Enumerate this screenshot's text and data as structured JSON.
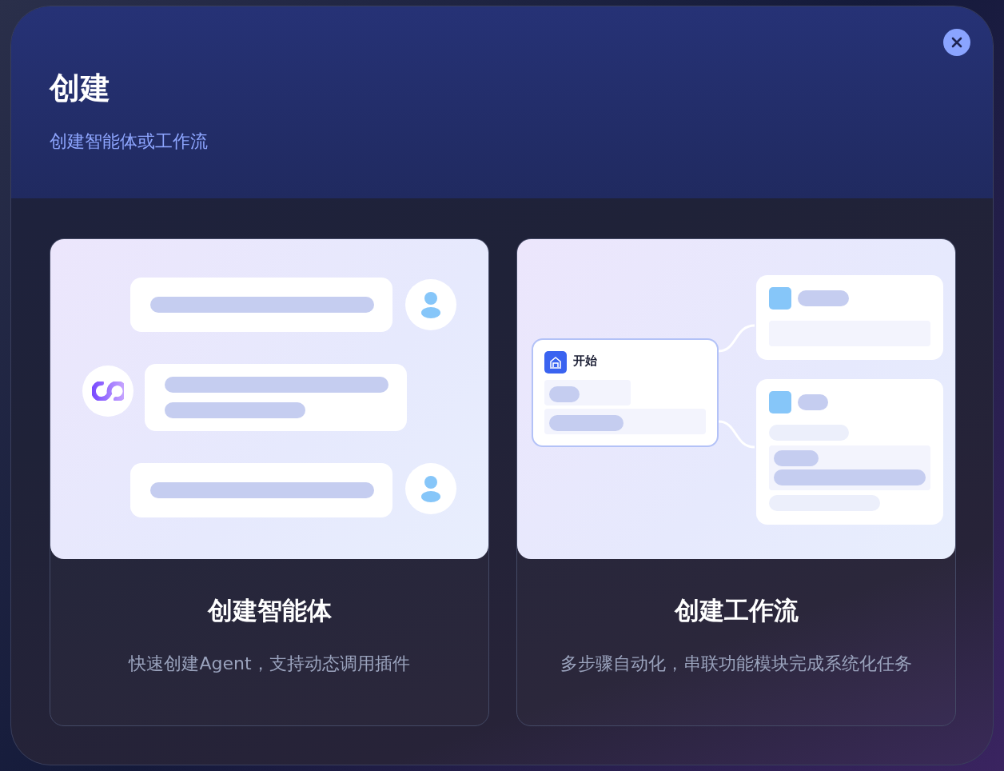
{
  "dialog": {
    "title": "创建",
    "subtitle": "创建智能体或工作流"
  },
  "cards": [
    {
      "kind": "agent",
      "title": "创建智能体",
      "description": "快速创建Agent，支持动态调用插件"
    },
    {
      "kind": "workflow",
      "title": "创建工作流",
      "description": "多步骤自动化，串联功能模块完成系统化任务",
      "start_label": "开始"
    }
  ]
}
